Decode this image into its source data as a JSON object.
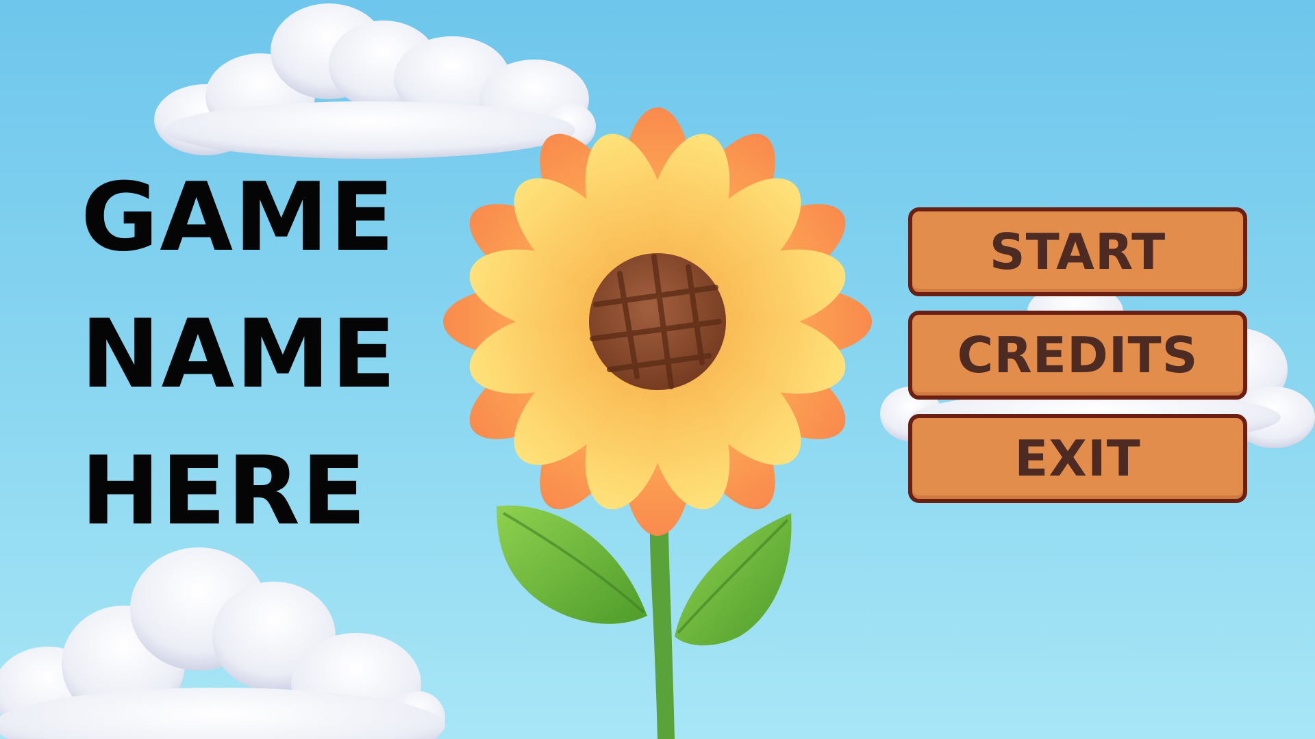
{
  "title": {
    "lines": [
      "GAME",
      "NAME",
      "HERE"
    ]
  },
  "menu": {
    "start_label": "START",
    "credits_label": "CREDITS",
    "exit_label": "EXIT"
  },
  "colors": {
    "sky_top": "#6ec6ec",
    "sky_bottom": "#a8e6f6",
    "button_fill": "#e38d4c",
    "button_border": "#6b1f12",
    "button_text": "#4d2a22",
    "title_text": "#050505",
    "petal_light": "#ffd76a",
    "petal_orange": "#f49a4e",
    "flower_center": "#8a4a30",
    "leaf_green": "#69b53a",
    "stem_green": "#5aa23a"
  },
  "icons": {
    "clouds": "cloud-icon",
    "flower": "sunflower-icon"
  }
}
